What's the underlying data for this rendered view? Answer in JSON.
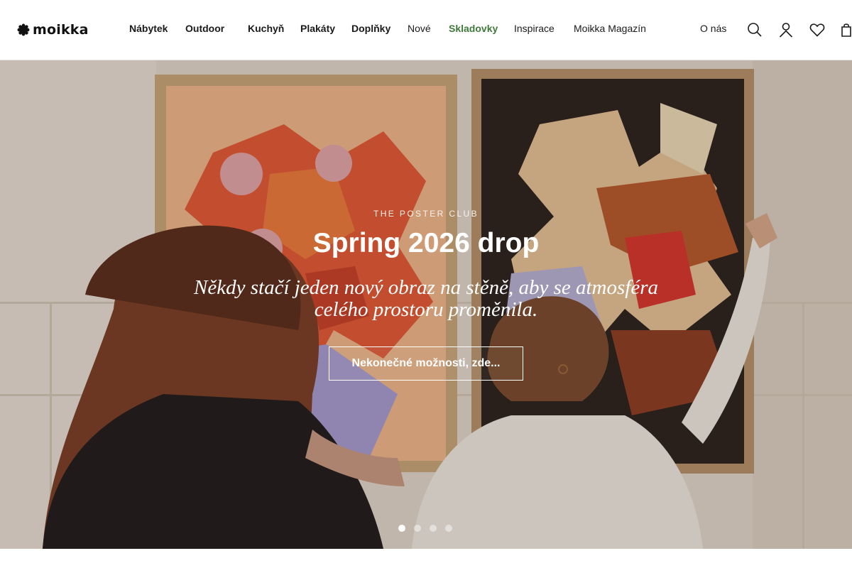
{
  "brand": {
    "name": "moikka"
  },
  "nav": {
    "items": [
      {
        "label": "Nábytek",
        "style": "bold"
      },
      {
        "label": "Outdoor",
        "style": "bold"
      },
      {
        "label": "Kuchyň",
        "style": "bold"
      },
      {
        "label": "Plakáty",
        "style": "bold"
      },
      {
        "label": "Doplňky",
        "style": "bold"
      },
      {
        "label": "Nové",
        "style": "normal"
      },
      {
        "label": "Skladovky",
        "style": "accent"
      },
      {
        "label": "Inspirace",
        "style": "normal"
      },
      {
        "label": "Moikka Magazín",
        "style": "normal"
      }
    ],
    "about": "O nás",
    "icons": [
      "search-icon",
      "account-icon",
      "wishlist-heart-icon",
      "cart-bag-icon"
    ]
  },
  "hero": {
    "kicker": "THE POSTER CLUB",
    "title": "Spring 2026 drop",
    "subtitle": "Někdy stačí jeden nový obraz na stěně, aby se atmosféra celého prostoru proměnila.",
    "cta": "Nekonečné možnosti, zde...",
    "slides": {
      "count": 4,
      "active": 1
    }
  },
  "colors": {
    "accent": "#3e7a3a",
    "text": "#1a1a1a",
    "hero_text": "#ffffff"
  }
}
